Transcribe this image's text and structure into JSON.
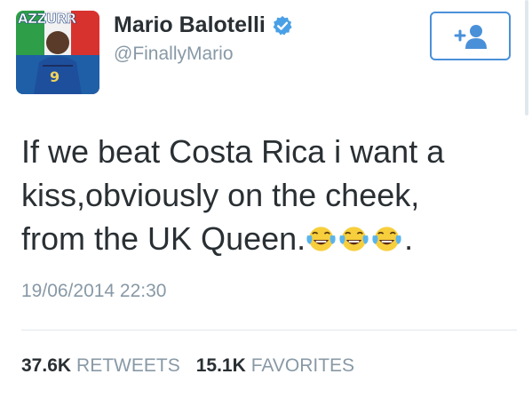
{
  "profile": {
    "avatar_text": "AZZURR",
    "display_name": "Mario Balotelli",
    "handle": "@FinallyMario",
    "verified_icon": "verified-badge-icon"
  },
  "follow_button": {
    "icon": "follow-user-icon"
  },
  "tweet": {
    "lines": [
      "If we beat Costa Rica i want a",
      "kiss,obviously on the cheek,",
      "from the UK Queen."
    ],
    "trailing_text": ".",
    "emoji": [
      "tears-of-joy-emoji",
      "tears-of-joy-emoji",
      "tears-of-joy-emoji"
    ],
    "timestamp": "19/06/2014 22:30"
  },
  "stats": {
    "retweets": {
      "count": "37.6K",
      "label": "RETWEETS"
    },
    "favorites": {
      "count": "15.1K",
      "label": "FAVORITES"
    }
  },
  "colors": {
    "text": "#292f33",
    "muted": "#8899a6",
    "accent": "#4a90d9",
    "divider": "#e1e8ed"
  }
}
